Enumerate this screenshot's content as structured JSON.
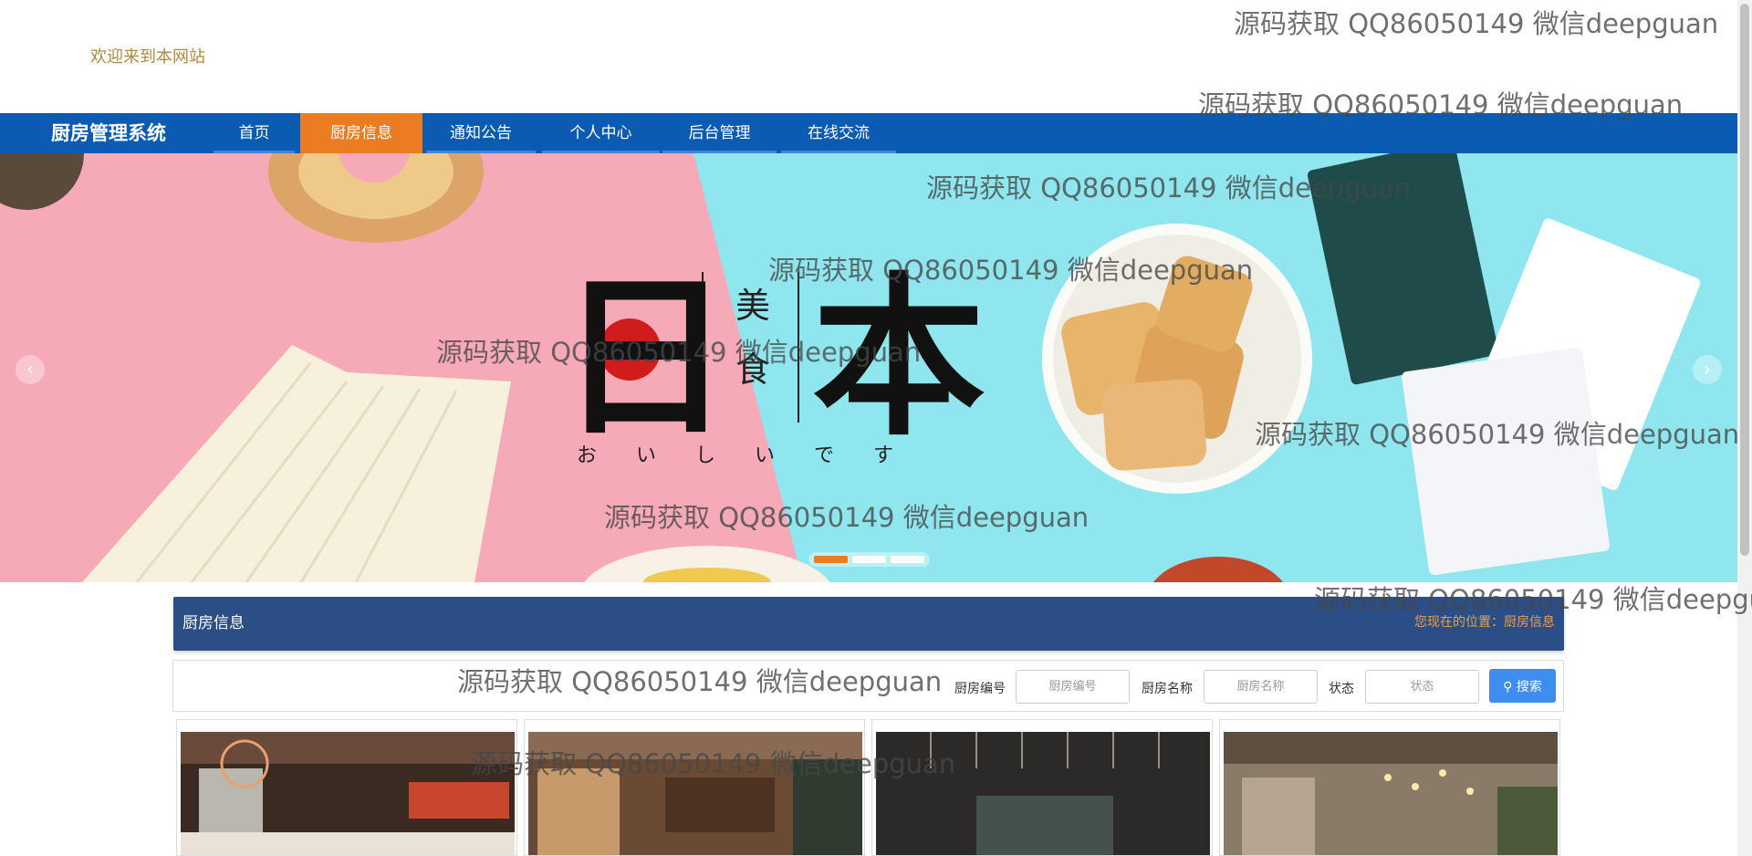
{
  "header": {
    "welcome": "欢迎来到本网站"
  },
  "nav": {
    "brand": "厨房管理系统",
    "items": [
      {
        "label": "首页"
      },
      {
        "label": "厨房信息",
        "active": true
      },
      {
        "label": "通知公告"
      },
      {
        "label": "个人中心"
      },
      {
        "label": "后台管理"
      },
      {
        "label": "在线交流"
      }
    ]
  },
  "banner": {
    "big_char_1": "日",
    "big_char_2": "本",
    "vertical_1": "美",
    "vertical_2": "食",
    "hiragana": "お い し い で す",
    "prev_icon": "chevron-left-icon",
    "next_icon": "chevron-right-icon",
    "slides_count": 3,
    "active_slide": 1
  },
  "section": {
    "title": "厨房信息",
    "breadcrumb": "您现在的位置：厨房信息"
  },
  "search": {
    "fields": [
      {
        "label": "厨房编号",
        "placeholder": "厨房编号"
      },
      {
        "label": "厨房名称",
        "placeholder": "厨房名称"
      },
      {
        "label": "状态",
        "placeholder": "状态"
      }
    ],
    "button_label": "搜索",
    "button_icon": "search-icon"
  },
  "watermark": "源码获取 QQ86050149 微信deepguan",
  "colors": {
    "nav_bg": "#0b5bb3",
    "nav_active": "#ec7c22",
    "section_bar": "#2c4e86",
    "search_button": "#3d8ef0"
  }
}
